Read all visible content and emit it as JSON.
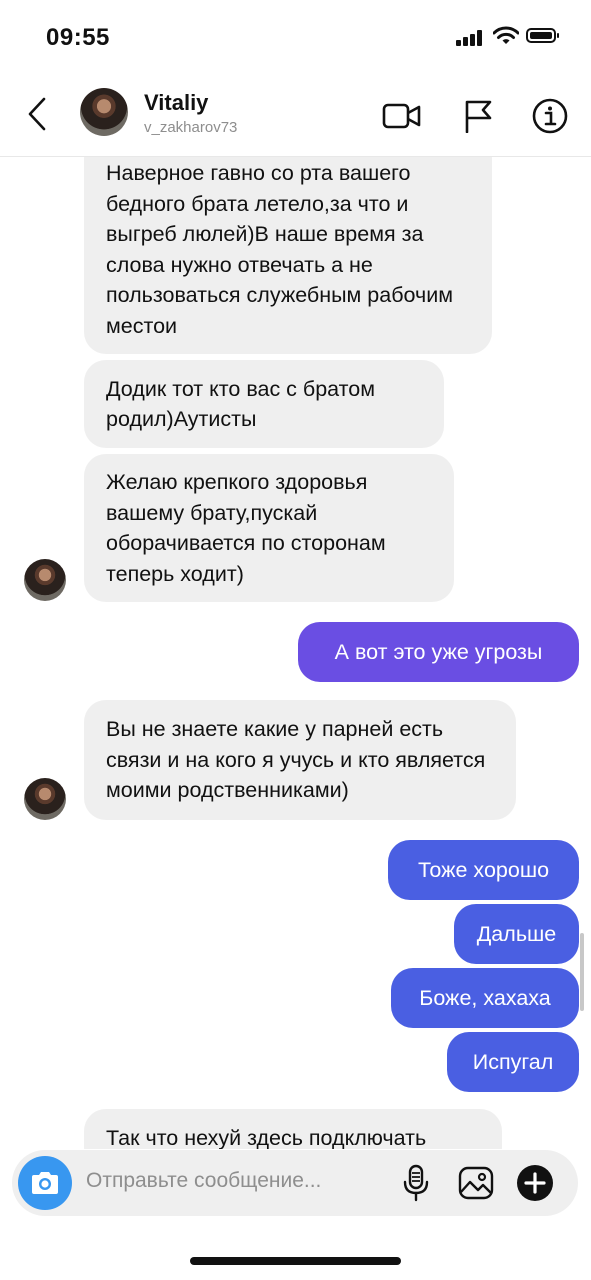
{
  "status_bar": {
    "time": "09:55"
  },
  "header": {
    "name": "Vitaliy",
    "handle": "v_zakharov73"
  },
  "messages": [
    {
      "direction": "incoming",
      "text": "Наверное гавно со рта вашего бедного брата летело,за что и выгреб люлей)В наше время за слова нужно отвечать а не пользоваться служебным рабочим местои"
    },
    {
      "direction": "incoming",
      "text": "Додик тот кто вас с братом родил)Аутисты"
    },
    {
      "direction": "incoming",
      "text": "Желаю крепкого здоровья вашему брату,пускай оборачивается по сторонам теперь ходит)"
    },
    {
      "direction": "outgoing",
      "text": "А вот это уже угрозы"
    },
    {
      "direction": "incoming",
      "text": "Вы не знаете какие у парней есть связи и на кого я учусь и кто является моими родственниками)"
    },
    {
      "direction": "outgoing",
      "text": "Тоже хорошо"
    },
    {
      "direction": "outgoing",
      "text": "Дальше"
    },
    {
      "direction": "outgoing",
      "text": "Боже, хахаха"
    },
    {
      "direction": "outgoing",
      "text": "Испугал"
    },
    {
      "direction": "incoming",
      "text": "Так что нехуй здесь подключать"
    }
  ],
  "composer": {
    "placeholder": "Отправьте сообщение..."
  },
  "colors": {
    "outgoing_bubble": "#4a5fe2",
    "outgoing_bubble_top": "#6a4ee3",
    "incoming_bubble": "#efefef",
    "camera_button": "#3897f0"
  },
  "icons": {
    "back": "chevron-left-icon",
    "video": "video-camera-icon",
    "report": "flag-icon",
    "info": "info-icon",
    "camera": "camera-icon",
    "mic": "microphone-icon",
    "gallery": "image-icon",
    "add": "plus-circle-icon"
  }
}
